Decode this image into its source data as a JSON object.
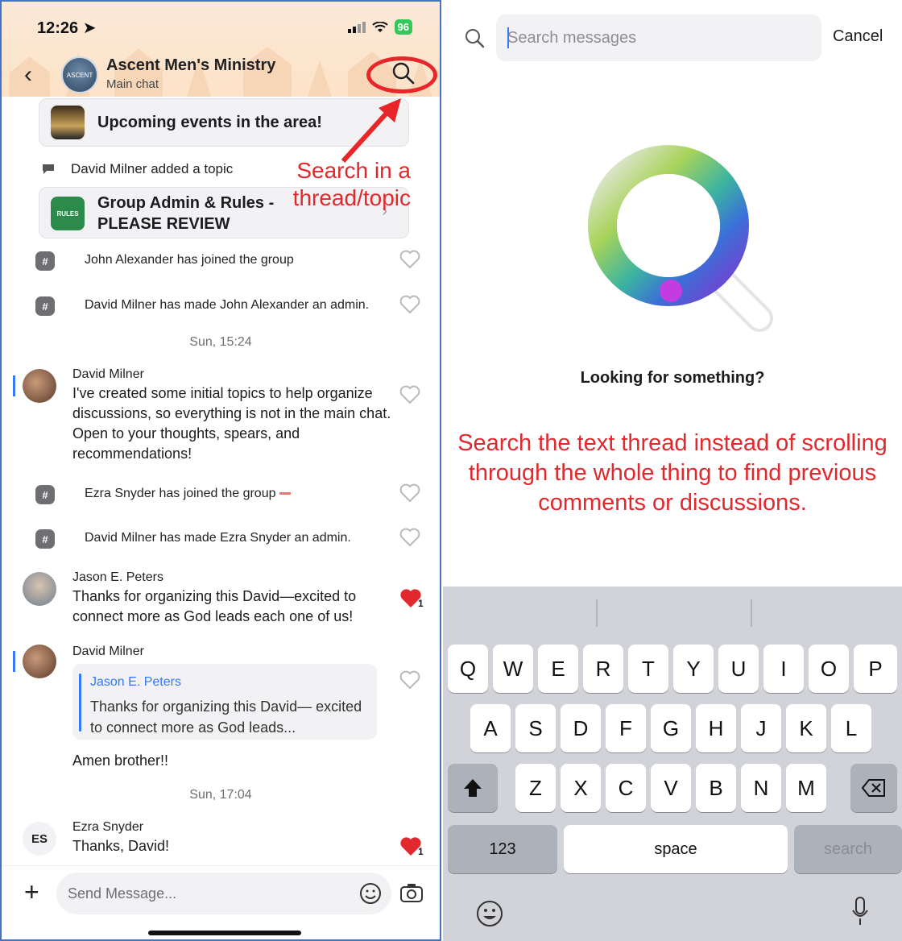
{
  "left_panel": {
    "status": {
      "time": "12:26",
      "battery": "96"
    },
    "header": {
      "group_name": "Ascent Men's Ministry",
      "subtitle": "Main chat",
      "avatar_text": "ASCENT"
    },
    "events_card": {
      "title": "Upcoming events in the area!"
    },
    "topic_notice": "David Milner added a topic",
    "topic_card": {
      "title_line1": "Group Admin & Rules -",
      "title_line2": "PLEASE REVIEW",
      "badge_text": "RULES"
    },
    "system_messages": [
      "John Alexander has joined the group",
      "David Milner has made John Alexander an admin.",
      "Ezra Snyder has joined the group",
      "David Milner has made Ezra Snyder an admin."
    ],
    "time_separators": [
      "Sun, 15:24",
      "Sun, 17:04"
    ],
    "messages": [
      {
        "author": "David Milner",
        "text": "I've created some initial topics to help organize discussions, so everything is not in the main chat. Open to your thoughts, spears, and recommendations!"
      },
      {
        "author": "Jason E. Peters",
        "text": "Thanks for organizing this David—excited to connect more as God leads each one of us!",
        "likes": "1"
      },
      {
        "author": "David Milner",
        "reply_author": "Jason E. Peters",
        "reply_text": "Thanks for organizing this David— excited to connect more as God leads...",
        "text": "Amen brother!!"
      },
      {
        "author": "Ezra Snyder",
        "initials": "ES",
        "text": "Thanks, David!",
        "likes": "1"
      }
    ],
    "composer": {
      "placeholder": "Send Message..."
    },
    "annotation": {
      "line1": "Search in a",
      "line2": "thread/topic"
    },
    "colors": {
      "accent": "#3478f6",
      "annotation_red": "#e0282d",
      "heart_red": "#e0282d"
    }
  },
  "right_panel": {
    "search": {
      "placeholder": "Search messages",
      "cancel": "Cancel"
    },
    "empty_state": "Looking for something?",
    "annotation": "Search the text thread instead of scrolling through the whole thing to find previous comments or discussions.",
    "keyboard": {
      "row1": [
        "Q",
        "W",
        "E",
        "R",
        "T",
        "Y",
        "U",
        "I",
        "O",
        "P"
      ],
      "row2": [
        "A",
        "S",
        "D",
        "F",
        "G",
        "H",
        "J",
        "K",
        "L"
      ],
      "row3": [
        "Z",
        "X",
        "C",
        "V",
        "B",
        "N",
        "M"
      ],
      "numbers_key": "123",
      "space_key": "space",
      "search_key": "search"
    }
  }
}
